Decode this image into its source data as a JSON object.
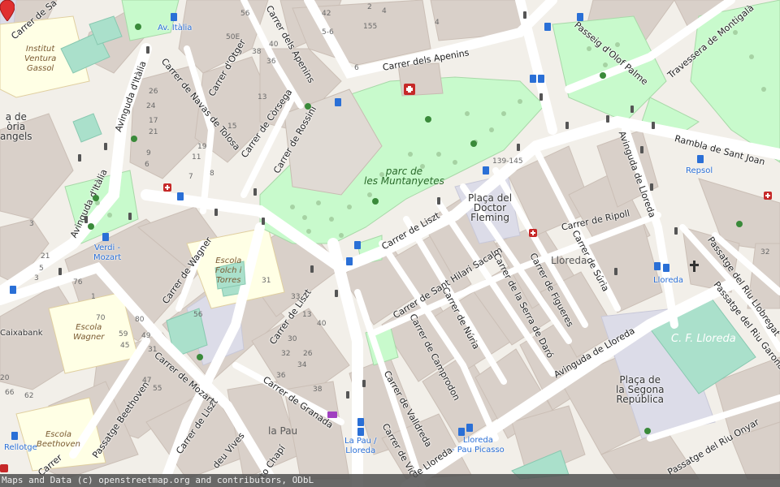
{
  "attribution": "Maps and Data (c) openstreetmap.org and contributors, ODbL",
  "colors": {
    "background": "#f2efe9",
    "block": "#d9d0c9",
    "park": "#c8facc",
    "school": "#ffffe5",
    "sports": "#aae0cb",
    "road": "#ffffff",
    "marker": "#e03030",
    "transit": "#2a6fd6",
    "amenity": "#c62828"
  },
  "streets": {
    "liszt_top": "Carrer de Liszt",
    "liszt_mid": "Carrer de Liszt",
    "liszt_low": "Carrer de Liszt",
    "apenins_top": "Carrer dels Apenins",
    "apenins_right": "Carrer dels Apenins",
    "rossini": "Carrer de Rossini",
    "corsega": "Carrer de Còrsega",
    "otger": "Carrer d'Otger",
    "navas": "Carrer de Navas de Tolosa",
    "italia_top": "Avinguda d'Itàlia",
    "italia_left": "Avinguda d'Itàlia",
    "wagner": "Carrer de Wagner",
    "mozart": "Carrer de Mozart",
    "beethoven": "Passatge Beethoven",
    "granada": "Carrer de Granada",
    "vives": "deu Vives",
    "chapi": "rto Chapí",
    "valldreda": "Carrer de Valldreda",
    "vic": "Carrer de Vic",
    "lloreda_bottom": "de Lloreda",
    "camprodon": "Carrer de Camprodon",
    "nuria": "Carrer de Núria",
    "sant_hilari": "Carrer de Sant Hilari Sacalm",
    "serra_daro": "Carrer de la Serra de Daró",
    "figueres": "Carrer de Figueres",
    "suria": "Carrer de Súria",
    "ripoll": "Carrer de Ripoll",
    "av_lloreda": "Avinguda de Lloreda",
    "av_lloreda_right": "Avinguda de Lloreda",
    "sant_joan": "Rambla de Sant Joan",
    "olof_palme": "Passeig d'Olof Palme",
    "montigala": "Travessera de Montigalà",
    "riu_llobregat": "Passatge del Riu Llobregat",
    "riu_garona": "Passatge del Riu Garona",
    "riu_onyar": "Passatge del Riu Onyar",
    "carrer_sa": "Carrer de Sa",
    "carrer_bottom_left": "Carrer"
  },
  "places": {
    "park_name": "parc de\nles Muntanyetes",
    "placa_fleming": "Plaça del\nDoctor\nFleming",
    "placa_republica": "Plaça de\nla Segona\nRepública",
    "cf_lloreda": "C. F. Lloreda",
    "lloreda_district": "Lloreda",
    "la_pau": "la Pau",
    "repsol": "Repsol",
    "caixabank": "Caixabank",
    "placa_angels": "a de\nòria\nangels",
    "rellotge": "Rellotge"
  },
  "schools": {
    "ventura_gassol": "Institut\nVentura\nGassol",
    "folch_torres": "Escola\nFolch i\nTorres",
    "escola_wagner": "Escola\nWagner",
    "escola_beethoven": "Escola\nBeethoven"
  },
  "transit": {
    "av_italia": "Av. Itàlia",
    "verdi_mozart": "Verdi -\nMozart",
    "lloreda_stop": "Lloreda",
    "la_pau_lloreda": "La Pau /\nLloreda",
    "lloreda_pau_picasso": "Lloreda\n- Pau Picasso"
  },
  "house_numbers": [
    "56",
    "50E",
    "40",
    "38",
    "36",
    "13",
    "26",
    "24",
    "17",
    "21",
    "19",
    "15",
    "11",
    "7",
    "9",
    "6",
    "8",
    "3",
    "21",
    "5",
    "3",
    "1",
    "76",
    "70",
    "80",
    "59",
    "49",
    "45",
    "47",
    "55",
    "31",
    "33",
    "13",
    "30",
    "26",
    "32",
    "34",
    "36",
    "38",
    "40",
    "139-145",
    "155",
    "2",
    "4",
    "6",
    "32",
    "5-6",
    "42",
    "4",
    "20",
    "66",
    "62",
    "56",
    "31"
  ]
}
